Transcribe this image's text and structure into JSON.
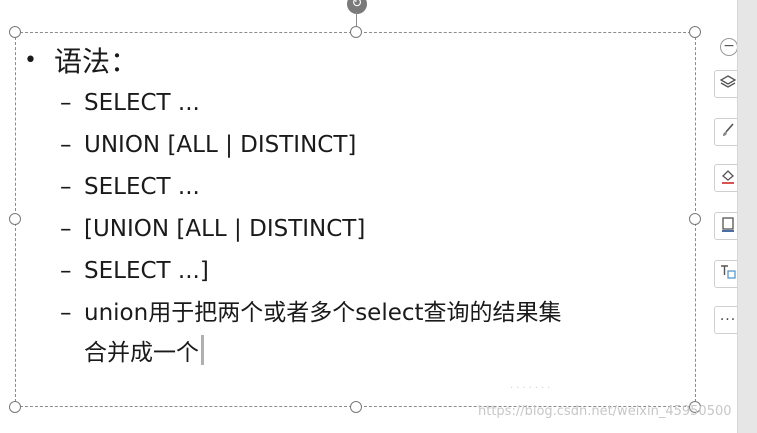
{
  "slide": {
    "bullet": "•",
    "heading": "语法：",
    "dash": "–",
    "items": [
      "SELECT ...",
      "UNION [ALL | DISTINCT]",
      "SELECT ...",
      "[UNION [ALL | DISTINCT]",
      "SELECT ...]"
    ],
    "last_item_line1": "union用于把两个或者多个select查询的结果集",
    "last_item_line2": "合并成一个"
  },
  "toolbar": {
    "collapse_label": "−",
    "more_label": "···",
    "buttons": [
      "layers-icon",
      "brush-icon",
      "fill-color-icon",
      "border-icon",
      "text-box-icon"
    ]
  },
  "rotate_glyph": "↻",
  "watermark": "https://blog.csdn.net/weixin_45950500"
}
